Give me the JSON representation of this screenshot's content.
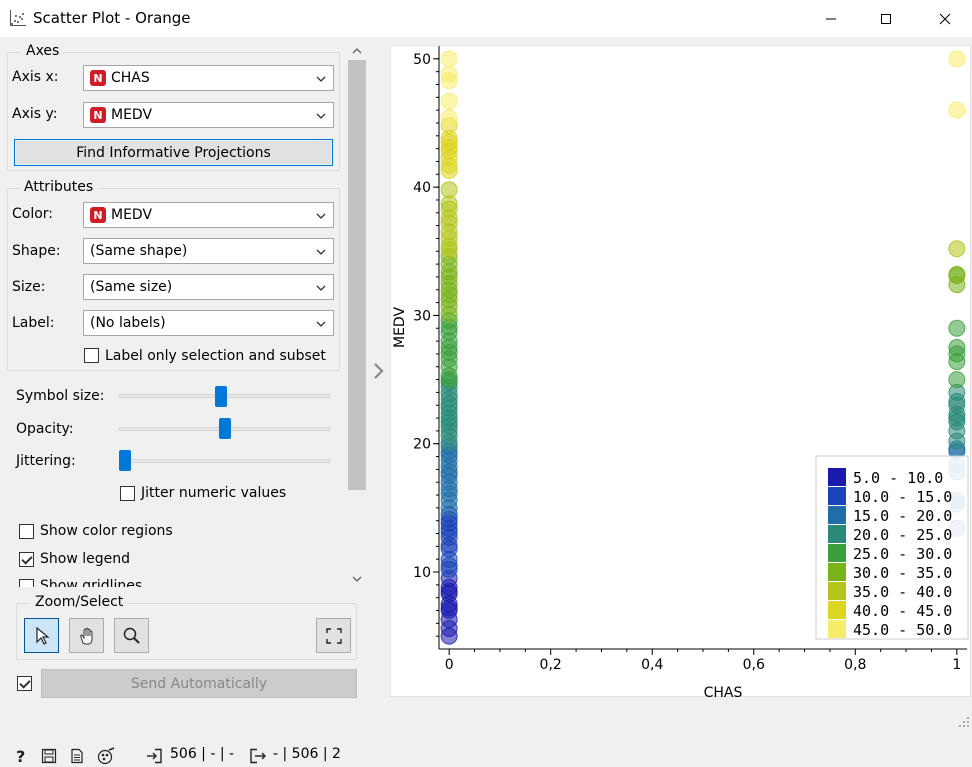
{
  "window": {
    "title": "Scatter Plot - Orange"
  },
  "axes": {
    "group_title": "Axes",
    "axis_x_label": "Axis x:",
    "axis_x_value": "CHAS",
    "axis_y_label": "Axis y:",
    "axis_y_value": "MEDV",
    "type_badge": "N",
    "find_button": "Find Informative Projections"
  },
  "attributes": {
    "group_title": "Attributes",
    "color_label": "Color:",
    "color_value": "MEDV",
    "shape_label": "Shape:",
    "shape_value": "(Same shape)",
    "size_label": "Size:",
    "size_value": "(Same size)",
    "label_label": "Label:",
    "label_value": "(No labels)",
    "label_only_selection": "Label only selection and subset"
  },
  "sliders": {
    "symbol_size_label": "Symbol size:",
    "symbol_size_level": 0.48,
    "opacity_label": "Opacity:",
    "opacity_level": 0.5,
    "jittering_label": "Jittering:",
    "jittering_level": 0.0,
    "jitter_numeric_label": "Jitter numeric values"
  },
  "options": {
    "show_color_regions": "Show color regions",
    "show_legend": "Show legend",
    "show_gridlines": "Show gridlines"
  },
  "zoom": {
    "group_title": "Zoom/Select"
  },
  "send": {
    "label": "Send Automatically"
  },
  "status": {
    "in_text": "506 | - | -",
    "out_text": "- | 506 | 2"
  },
  "chart_data": {
    "type": "scatter",
    "xlabel": "CHAS",
    "ylabel": "MEDV",
    "xlim": [
      -0.02,
      1.02
    ],
    "ylim": [
      4.0,
      51.0
    ],
    "x_ticks": [
      "0",
      "0,2",
      "0,4",
      "0,6",
      "0,8",
      "1"
    ],
    "x_tick_values": [
      0,
      0.2,
      0.4,
      0.6,
      0.8,
      1.0
    ],
    "y_ticks": [
      "10",
      "20",
      "30",
      "40",
      "50"
    ],
    "y_tick_values": [
      10,
      20,
      30,
      40,
      50
    ],
    "grid": false,
    "legend_position": "bottom-right",
    "legend": [
      {
        "label": "5.0 - 10.0",
        "color": "#1a1aaf"
      },
      {
        "label": "10.0 - 15.0",
        "color": "#1b44b8"
      },
      {
        "label": "15.0 - 20.0",
        "color": "#1f6ea8"
      },
      {
        "label": "20.0 - 25.0",
        "color": "#2a8a78"
      },
      {
        "label": "25.0 - 30.0",
        "color": "#3a9f3a"
      },
      {
        "label": "30.0 - 35.0",
        "color": "#78b31a"
      },
      {
        "label": "35.0 - 40.0",
        "color": "#b3c51a"
      },
      {
        "label": "40.0 - 45.0",
        "color": "#dcd622"
      },
      {
        "label": "45.0 - 50.0",
        "color": "#f7ec6a"
      }
    ],
    "series": [
      {
        "x": 0,
        "y": [
          5.0,
          5.6,
          6.3,
          7.0,
          7.2,
          7.5,
          8.3,
          8.5,
          8.8,
          9.5,
          10.2,
          10.5,
          11.0,
          11.8,
          12.1,
          12.7,
          13.1,
          13.4,
          13.8,
          14.1,
          14.5,
          15.0,
          15.6,
          16.1,
          16.5,
          17.0,
          17.5,
          17.8,
          18.2,
          18.7,
          19.1,
          19.4,
          19.8,
          20.1,
          20.6,
          21.0,
          21.4,
          21.7,
          22.0,
          22.4,
          22.8,
          23.1,
          23.5,
          23.9,
          24.4,
          24.8,
          25.0,
          25.3,
          26.0,
          26.6,
          27.1,
          27.5,
          28.0,
          28.7,
          29.1,
          29.6,
          30.1,
          30.7,
          31.2,
          31.6,
          32.0,
          32.5,
          33.0,
          33.4,
          34.0,
          34.6,
          35.1,
          35.4,
          36.0,
          36.5,
          37.2,
          37.6,
          38.3,
          38.7,
          39.8,
          41.3,
          41.7,
          42.3,
          42.8,
          43.1,
          43.5,
          43.8,
          44.8,
          45.4,
          46.7,
          48.3,
          48.8,
          50.0
        ]
      },
      {
        "x": 1,
        "y": [
          13.4,
          15.3,
          15.6,
          17.8,
          18.4,
          19.4,
          19.6,
          20.2,
          21.0,
          21.7,
          22.0,
          22.3,
          23.0,
          23.3,
          24.0,
          25.0,
          26.4,
          27.0,
          27.5,
          29.0,
          32.4,
          33.1,
          33.2,
          35.2,
          46.0,
          50.0
        ]
      }
    ]
  }
}
